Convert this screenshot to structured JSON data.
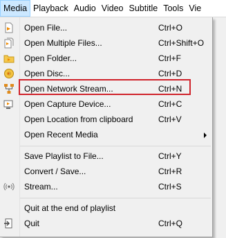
{
  "menubar": {
    "items": [
      "Media",
      "Playback",
      "Audio",
      "Video",
      "Subtitle",
      "Tools",
      "Vie"
    ]
  },
  "menu": {
    "items": [
      {
        "label": "Open File...",
        "shortcut": "Ctrl+O",
        "icon": "file-icon"
      },
      {
        "label": "Open Multiple Files...",
        "shortcut": "Ctrl+Shift+O",
        "icon": "files-icon"
      },
      {
        "label": "Open Folder...",
        "shortcut": "Ctrl+F",
        "icon": "folder-icon"
      },
      {
        "label": "Open Disc...",
        "shortcut": "Ctrl+D",
        "icon": "disc-icon"
      },
      {
        "label": "Open Network Stream...",
        "shortcut": "Ctrl+N",
        "icon": "network-icon"
      },
      {
        "label": "Open Capture Device...",
        "shortcut": "Ctrl+C",
        "icon": "capture-icon"
      },
      {
        "label": "Open Location from clipboard",
        "shortcut": "Ctrl+V",
        "icon": ""
      },
      {
        "label": "Open Recent Media",
        "shortcut": "",
        "icon": "",
        "submenu": true
      },
      {
        "label": "Save Playlist to File...",
        "shortcut": "Ctrl+Y",
        "icon": ""
      },
      {
        "label": "Convert / Save...",
        "shortcut": "Ctrl+R",
        "icon": ""
      },
      {
        "label": "Stream...",
        "shortcut": "Ctrl+S",
        "icon": "stream-icon"
      },
      {
        "label": "Quit at the end of playlist",
        "shortcut": "",
        "icon": ""
      },
      {
        "label": "Quit",
        "shortcut": "Ctrl+Q",
        "icon": "quit-icon"
      }
    ]
  },
  "highlighted_item": "Open Network Stream...",
  "colors": {
    "highlight_border": "#d0232b",
    "menubar_active": "#cce8ff",
    "menu_bg": "#f0f0f0"
  }
}
